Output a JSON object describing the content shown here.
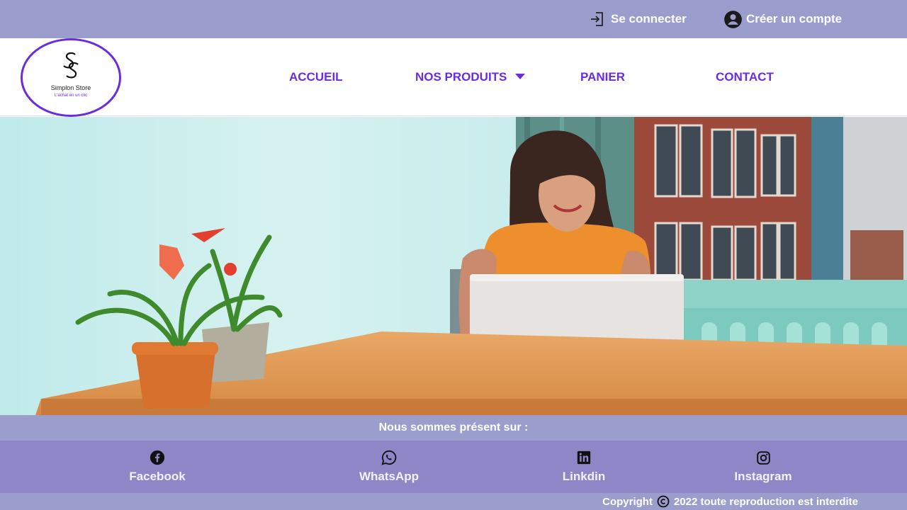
{
  "topbar": {
    "login_label": "Se connecter",
    "signup_label": "Créer un compte"
  },
  "logo": {
    "monogram": "SS",
    "name": "Simplon Store",
    "tagline": "L'achat en un clic"
  },
  "nav": {
    "items": [
      {
        "label": "ACCUEIL"
      },
      {
        "label": "NOS PRODUITS"
      },
      {
        "label": "PANIER"
      },
      {
        "label": "CONTACT"
      }
    ]
  },
  "footer": {
    "present_label": "Nous sommes présent sur :",
    "socials": [
      {
        "label": "Facebook",
        "icon": "facebook-icon"
      },
      {
        "label": "WhatsApp",
        "icon": "whatsapp-icon"
      },
      {
        "label": "Linkdin",
        "icon": "linkedin-icon"
      },
      {
        "label": "Instagram",
        "icon": "instagram-icon"
      }
    ],
    "copyright_prefix": "Copyright",
    "copyright_text": "2022 toute reproduction est interdite"
  },
  "colors": {
    "topbar_bg": "#9b9dcc",
    "accent_purple": "#6a2ce0",
    "social_bg": "#8f86c8"
  }
}
